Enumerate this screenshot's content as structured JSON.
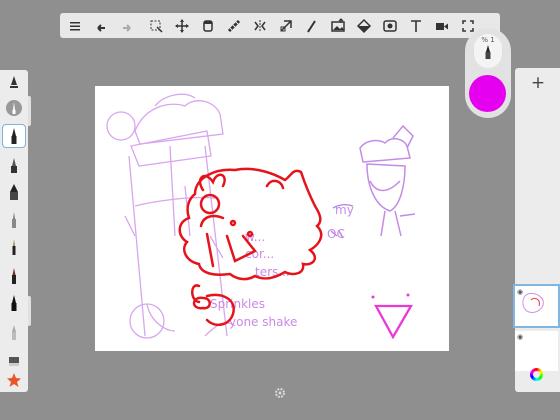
{
  "app": {
    "background": "#8f8f8f"
  },
  "toolbar": {
    "tools": [
      "list-icon",
      "undo-icon",
      "redo-icon",
      "selection-icon",
      "transform-icon",
      "layers-stack-icon",
      "ruler-icon",
      "symmetry-icon",
      "distort-icon",
      "pen-icon",
      "image-import-icon",
      "fill-icon",
      "stencil-icon",
      "text-icon",
      "video-icon",
      "fullscreen-icon"
    ]
  },
  "brush": {
    "opacity_label": "% 1",
    "size_fraction": 1.0
  },
  "color": {
    "current": "#e600f0"
  },
  "layers": {
    "add_label": "+",
    "count": 2
  },
  "canvas": {
    "background": "#ffffff"
  },
  "drawing_text": [
    "my",
    "OC",
    "w...",
    "cor...",
    "ters...",
    "Sprinkles",
    "yone shake"
  ]
}
